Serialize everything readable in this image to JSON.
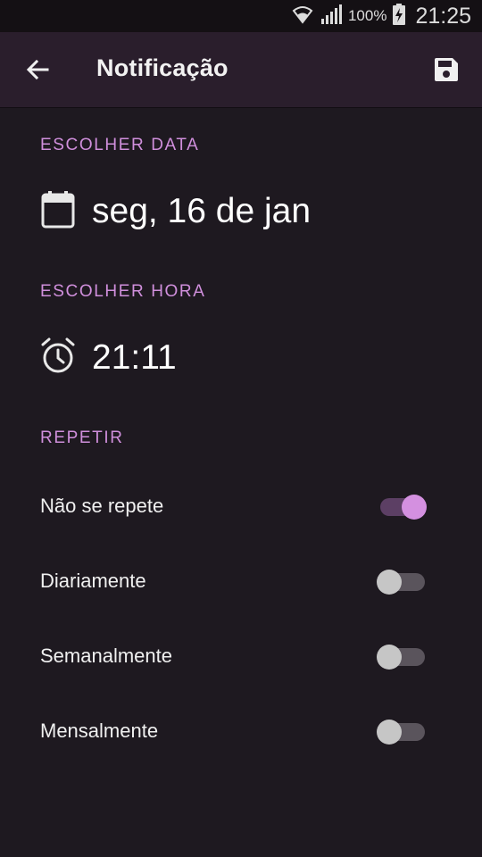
{
  "status_bar": {
    "battery_percent": "100%",
    "time": "21:25",
    "icons": [
      "wifi-icon",
      "signal-icon",
      "battery-charging-icon"
    ]
  },
  "app_bar": {
    "title": "Notificação",
    "back_icon": "arrow-back-icon",
    "save_icon": "save-icon"
  },
  "date_section": {
    "label": "ESCOLHER DATA",
    "value": "seg, 16 de jan",
    "icon": "calendar-icon"
  },
  "time_section": {
    "label": "ESCOLHER HORA",
    "value": "21:11",
    "icon": "alarm-icon"
  },
  "repeat_section": {
    "label": "REPETIR",
    "options": [
      {
        "label": "Não se repete",
        "checked": true
      },
      {
        "label": "Diariamente",
        "checked": false
      },
      {
        "label": "Semanalmente",
        "checked": false
      },
      {
        "label": "Mensalmente",
        "checked": false
      }
    ]
  },
  "colors": {
    "background": "#1e1920",
    "app_bar": "#2a1e2c",
    "accent": "#d08fdc"
  }
}
